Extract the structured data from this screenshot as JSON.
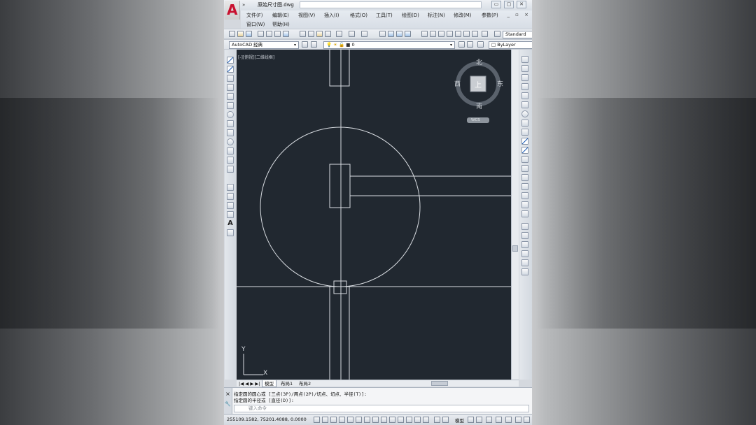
{
  "window": {
    "file_title": "原始尺寸图.dwg",
    "min_label": "▭",
    "max_label": "▢",
    "close_label": "✕"
  },
  "menu": {
    "row1": [
      "文件(F)",
      "编辑(E)",
      "视图(V)",
      "插入(I)",
      "格式(O)",
      "工具(T)",
      "绘图(D)",
      "标注(N)",
      "修改(M)",
      "参数(P)"
    ],
    "row2": [
      "窗口(W)",
      "帮助(H)"
    ],
    "mdi": "_ ▫ ×"
  },
  "toolbar": {
    "text_style": "Standard",
    "workspace": "AutoCAD 经典",
    "layer": "0",
    "color": "ByLayer"
  },
  "viewport": {
    "label": "[-][俯视][二维线框]"
  },
  "viewcube": {
    "north": "北",
    "south": "南",
    "east": "东",
    "west": "西",
    "face": "上",
    "wcs": "WCS"
  },
  "ucs": {
    "y": "Y",
    "x": "X"
  },
  "tabs": {
    "nav": "|◀ ◀ ▶ ▶|",
    "model": "模型",
    "layout1": "布局1",
    "layout2": "布局2"
  },
  "command": {
    "side1": "×",
    "side2": "🔧",
    "line1": "指定圆的圆心或 [三点(3P)/两点(2P)/切点、切点、半径(T)]:",
    "line2": "指定圆的半径或 [直径(D)]:",
    "placeholder": "键入命令"
  },
  "status": {
    "coords": "255109.1582, 75201.4088, 0.0000",
    "model": "模型"
  },
  "colors": {
    "canvas": "#212830",
    "geometry": "#d9dde2",
    "accent": "#c8102e"
  }
}
